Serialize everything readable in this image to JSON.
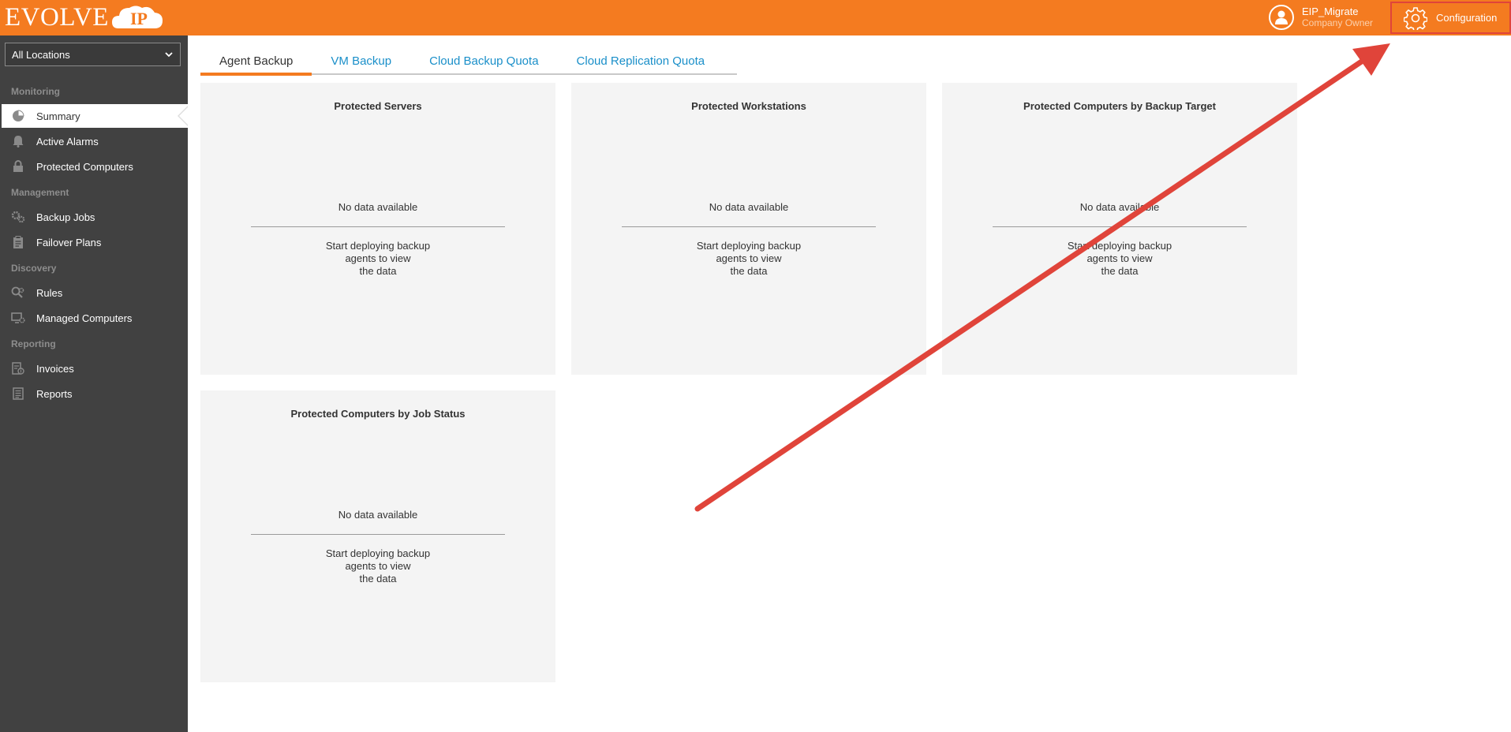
{
  "brand": {
    "logo_text": "EVOLVE",
    "logo_badge": "IP",
    "accent_color": "#f47b20"
  },
  "header": {
    "user_name": "EIP_Migrate",
    "user_role": "Company Owner",
    "configuration_label": "Configuration"
  },
  "sidebar": {
    "location_selected": "All Locations",
    "sections": {
      "monitoring": "Monitoring",
      "management": "Management",
      "discovery": "Discovery",
      "reporting": "Reporting"
    },
    "items": [
      {
        "label": "Summary",
        "icon": "pie-chart-icon",
        "active": true
      },
      {
        "label": "Active Alarms",
        "icon": "bell-icon"
      },
      {
        "label": "Protected Computers",
        "icon": "lock-icon"
      },
      {
        "label": "Backup Jobs",
        "icon": "gears-icon"
      },
      {
        "label": "Failover Plans",
        "icon": "clipboard-icon"
      },
      {
        "label": "Rules",
        "icon": "discovery-gear-icon"
      },
      {
        "label": "Managed Computers",
        "icon": "monitor-gear-icon"
      },
      {
        "label": "Invoices",
        "icon": "invoice-icon"
      },
      {
        "label": "Reports",
        "icon": "report-icon"
      }
    ]
  },
  "tabs": [
    {
      "label": "Agent Backup",
      "active": true
    },
    {
      "label": "VM Backup"
    },
    {
      "label": "Cloud Backup Quota"
    },
    {
      "label": "Cloud Replication Quota"
    }
  ],
  "cards": [
    {
      "title": "Protected Servers",
      "empty": "No data available",
      "hint_1": "Start deploying backup",
      "hint_2": "agents to view",
      "hint_3": "the data"
    },
    {
      "title": "Protected Workstations",
      "empty": "No data available",
      "hint_1": "Start deploying backup",
      "hint_2": "agents to view",
      "hint_3": "the data"
    },
    {
      "title": "Protected Computers by Backup Target",
      "empty": "No data available",
      "hint_1": "Start deploying backup",
      "hint_2": "agents to view",
      "hint_3": "the data"
    },
    {
      "title": "Protected Computers by Job Status",
      "empty": "No data available",
      "hint_1": "Start deploying backup",
      "hint_2": "agents to view",
      "hint_3": "the data"
    }
  ],
  "annotation": {
    "arrow_color": "#e0443a",
    "target": "configuration-button"
  }
}
